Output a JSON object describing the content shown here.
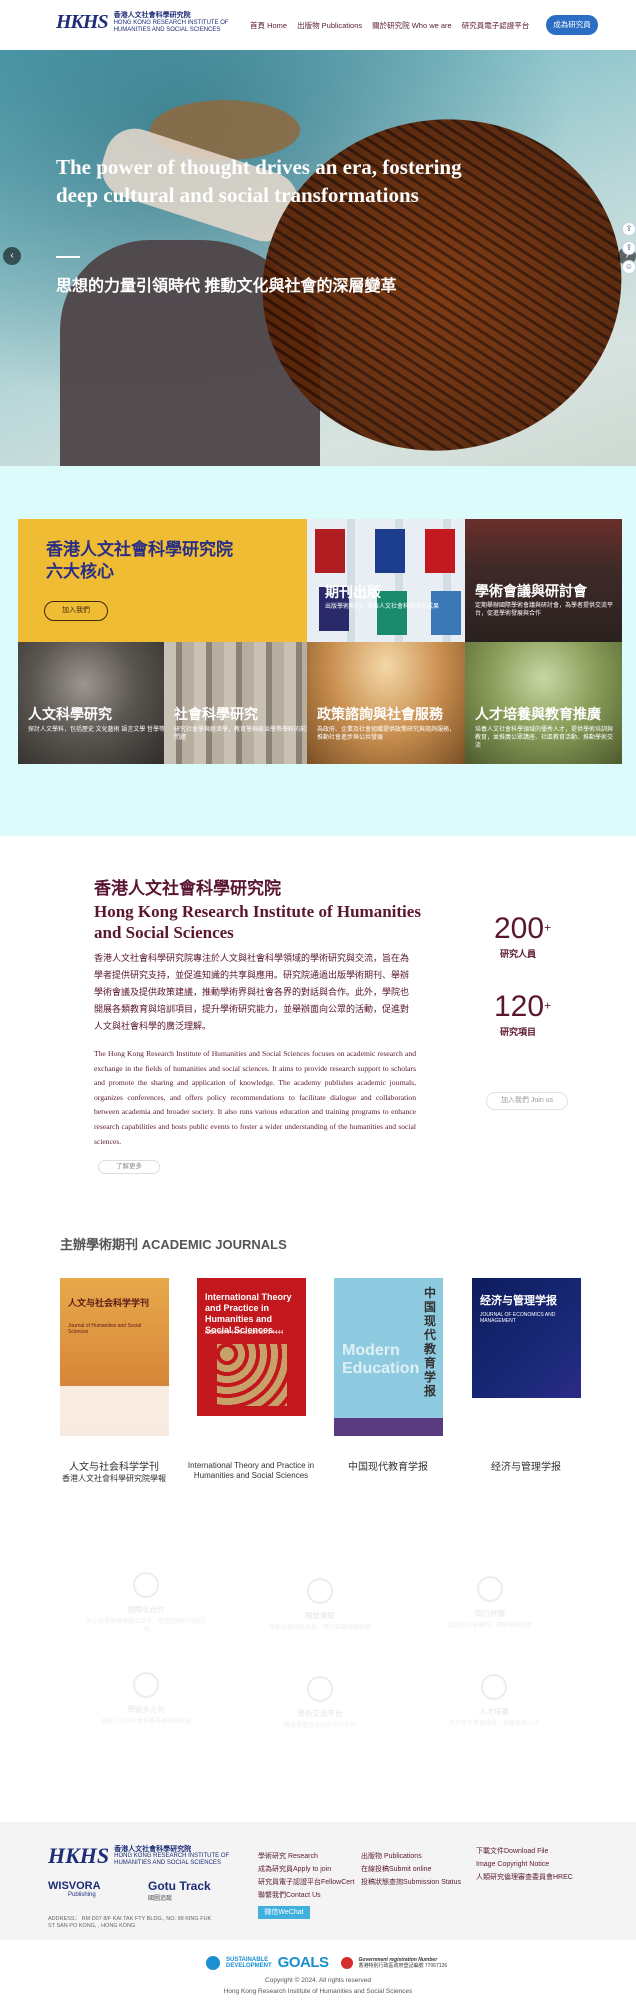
{
  "header": {
    "logo_mark": "HKHS",
    "logo_cn": "香港人文社會科學研究院",
    "logo_en1": "HONG KONG RESEARCH INSTITUTE OF",
    "logo_en2": "HUMANITIES AND SOCIAL SCIENCES",
    "nav": [
      "首頁 Home",
      "出版物 Publications",
      "關於研究院 Who we are",
      "研究員電子認證平台"
    ],
    "cta": "成為研究員"
  },
  "hero": {
    "title": "The power of thought drives an era, fostering deep cultural and social transformations",
    "subtitle": "思想的力量引領時代  推動文化與社會的深層變革",
    "prev": "‹",
    "next": "›"
  },
  "side_tools": [
    "⇪",
    "⇪",
    "☺"
  ],
  "cores": {
    "intro_title": "香港人文社會科學研究院",
    "intro_title2": "六大核心",
    "join": "加入我們",
    "tiles": [
      {
        "title": "期刊出版",
        "desc": "出版學術期刊，發表人文社會科學研究成果"
      },
      {
        "title": "學術會議與研討會",
        "desc": "定期舉辦國際學術會議與研討會，為學者提供交流平台，促進學術發展與合作"
      },
      {
        "title": "人文科學研究",
        "desc": "探討人文學科，包括歷史 文化藝術 語言文學 哲學等"
      },
      {
        "title": "社會科學研究",
        "desc": "研究社會學與經濟學，教育學與政治學等學科的前沿問題"
      },
      {
        "title": "政策諮詢與社會服務",
        "desc": "為政府、企業及社會組織提供政策研究與諮詢服務，推動社會進步與公共發展"
      },
      {
        "title": "人才培養與教育推廣",
        "desc": "培養人文社會科學領域的優秀人才，提供學術培訓與教育，並推廣公眾講座、社區教育活動、推動學術交流"
      }
    ]
  },
  "about": {
    "title_cn": "香港人文社會科學研究院",
    "title_en": "Hong Kong Research Institute of Humanities and Social Sciences",
    "body_cn": "香港人文社會科學研究院專注於人文與社會科學領域的學術研究與交流，旨在為學者提供研究支持，並促進知識的共享與應用。研究院通過出版學術期刊、舉辦學術會議及提供政策建議，推動學術界與社會各界的對話與合作。此外，學院也開展各類教育與培訓項目，提升學術研究能力，並舉辦面向公眾的活動，促進對人文與社會科學的廣泛理解。",
    "body_en": "The Hong Kong Research Institute of Humanities and Social Sciences focuses on academic research and exchange in the fields of humanities and social sciences. It aims to provide research support to scholars and promote the sharing and application of knowledge. The academy publishes academic journals, organizes conferences, and offers policy recommendations to facilitate dialogue and collaboration between academia and broader society. It also runs various education and training programs to enhance research capabilities and hosts public events to foster a wider understanding of the humanities and social sciences.",
    "more": "了解更多",
    "stats": [
      {
        "num": "200",
        "sup": "+",
        "label": "研究人員"
      },
      {
        "num": "120",
        "sup": "+",
        "label": "研究項目"
      }
    ],
    "join_us": "加入我們 Join us"
  },
  "journals": {
    "heading": "主辦學術期刊 ACADEMIC JOURNALS",
    "items": [
      {
        "cover_title": "人文与社会科学学刊",
        "cover_sub": "Journal of Humanities and Social Sciences",
        "caption": "人文与社会科学学刊",
        "caption2": "香港人文社會科學研究院學報",
        "color": "#e09a3e"
      },
      {
        "cover_title": "International Theory and Practice in Humanities and Social Sciences",
        "cover_sub": "ISSN 3079-4479  eISSN 3079-4444",
        "caption": "International Theory and Practice in Humanities and Social Sciences",
        "caption2": "",
        "color": "#c2181d"
      },
      {
        "cover_title": "中国现代教育学报",
        "cover_sub": "Modern Education",
        "caption": "中国现代教育学报",
        "caption2": "",
        "color": "#8fcbe0"
      },
      {
        "cover_title": "经济与管理学报",
        "cover_sub": "JOURNAL OF ECONOMICS AND MANAGEMENT",
        "caption": "经济与管理学报",
        "caption2": "",
        "color": "#0e1c5e"
      }
    ]
  },
  "features": [
    {
      "title": "國際化合作",
      "desc": "與全球學術機構建立合作，促進跨國研究與交流"
    },
    {
      "title": "開放獲取",
      "desc": "學術成果開放共享，擴大知識傳播影響"
    },
    {
      "title": "同行評審",
      "desc": "嚴謹的評審機制，確保學術質量"
    },
    {
      "title": "學術多元化",
      "desc": "涵蓋人文與社會科學多個學科領域"
    },
    {
      "title": "學術交流平台",
      "desc": "搭建學者交流與合作的平台"
    },
    {
      "title": "人才培養",
      "desc": "支持青年學者成長，培養學術人才"
    }
  ],
  "footer": {
    "logo_mark": "HKHS",
    "logo_cn": "香港人文社會科學研究院",
    "logo_en1": "HONG KONG RESEARCH INSTITUTE OF",
    "logo_en2": "HUMANITIES AND SOCIAL SCIENCES",
    "wisvora": "WISVORA",
    "wisvora_sub": "Publishing",
    "gotu": "Gotu Track",
    "gotu_sub": "國圖追蹤",
    "address": "ADDRESS： RM D07 8/F KAI TAK FTY BLDG., NO. 99 KING FUK ST SAN PO KONG, , HONG KONG",
    "col1": [
      "學術研究 Research",
      "成為研究員Apply to join",
      "研究員電子認證平台FellowCert",
      "聯繫我們Contact Us"
    ],
    "wechat": "微信WeChat",
    "col2": [
      "出版物 Publications",
      "在線投稿Submit online",
      "投稿狀態查詢Submission Status"
    ],
    "col3": [
      "下載文件Download File",
      "Image Copyright Notice",
      "人類研究倫理審查委員會HREC"
    ]
  },
  "bottom": {
    "sdg1": "SUSTAINABLE",
    "sdg2": "DEVELOPMENT",
    "goals": "GOALS",
    "reg1": "Government registration Number",
    "reg2": "香港特別行政區政府登記編號 77067126",
    "copyright": "Copyright © 2024. All rights reserved",
    "org": "Hong Kong Research Institute of Humanities and Social Sciences"
  }
}
